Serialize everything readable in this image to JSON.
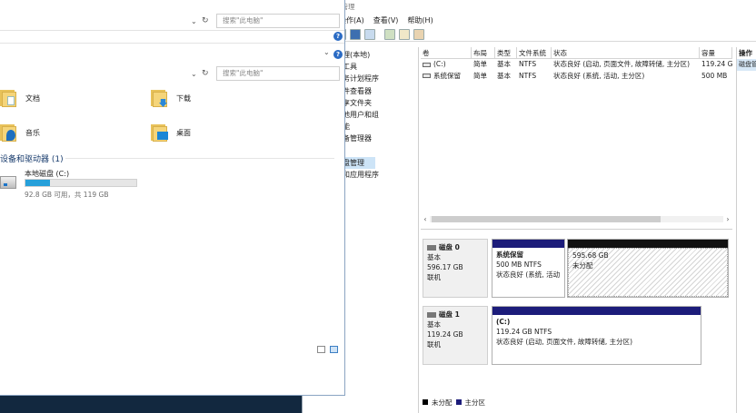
{
  "cm": {
    "title": "计算机管理",
    "menu": [
      "操作(A)",
      "查看(V)",
      "帮助(H)"
    ],
    "tree": [
      "理(本地)",
      "工具",
      "务计划程序",
      "件查看器",
      "享文件夹",
      "地用户和组",
      "能",
      "备管理器",
      "",
      "盘管理",
      "和应用程序"
    ],
    "volumes": {
      "columns": [
        "卷",
        "布局",
        "类型",
        "文件系统",
        "状态",
        "容量"
      ],
      "rows": [
        [
          "(C:)",
          "简单",
          "基本",
          "NTFS",
          "状态良好 (启动, 页面文件, 故障转储, 主分区)",
          "119.24 G"
        ],
        [
          "系统保留",
          "简单",
          "基本",
          "NTFS",
          "状态良好 (系统, 活动, 主分区)",
          "500 MB"
        ]
      ]
    },
    "disks": [
      {
        "name": "磁盘 0",
        "type": "基本",
        "size": "596.17 GB",
        "state": "联机",
        "partitions": [
          {
            "name": "系统保留",
            "size": "500 MB NTFS",
            "status": "状态良好 (系统, 活动"
          },
          {
            "name": "",
            "size": "595.68 GB",
            "status": "未分配"
          }
        ]
      },
      {
        "name": "磁盘 1",
        "type": "基本",
        "size": "119.24 GB",
        "state": "联机",
        "partitions": [
          {
            "name": "(C:)",
            "size": "119.24 GB NTFS",
            "status": "状态良好 (启动, 页面文件, 故障转储, 主分区)"
          }
        ]
      }
    ],
    "legend": {
      "unallocated": "未分配",
      "primary": "主分区"
    },
    "actions": {
      "header": "操作",
      "item": "磁盘管"
    }
  },
  "fe": {
    "search_placeholder_1": "搜索\"此电脑\"",
    "search_placeholder_2": "搜索\"此电脑\"",
    "folders": [
      "文档",
      "下载",
      "音乐",
      "桌面"
    ],
    "section": "设备和驱动器 (1)",
    "drive": {
      "name": "本地磁盘 (C:)",
      "free": "92.8 GB 可用，共 119 GB",
      "used_fraction": 0.22
    }
  }
}
